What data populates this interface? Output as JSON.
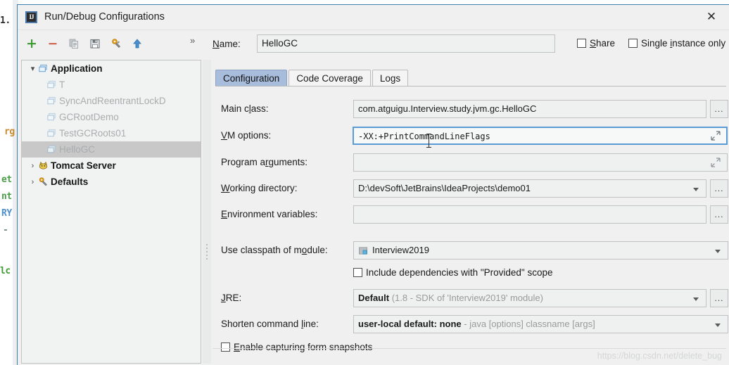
{
  "window": {
    "title": "Run/Debug Configurations",
    "icon": "intellij-idea-icon",
    "close_label": "✕"
  },
  "toolbar": {
    "items": [
      {
        "name": "add-configuration-button",
        "glyph": "plus",
        "color": "#3f9c35"
      },
      {
        "name": "remove-configuration-button",
        "glyph": "minus",
        "color": "#cc5a45"
      },
      {
        "name": "copy-configuration-button",
        "glyph": "copy",
        "color": "#9aa0a3"
      },
      {
        "name": "save-configuration-button",
        "glyph": "save",
        "color": "#6d7579"
      },
      {
        "name": "edit-defaults-button",
        "glyph": "wrench",
        "color": "#e3a01a"
      },
      {
        "name": "move-up-button",
        "glyph": "arrow-up",
        "color": "#4a8fd0"
      }
    ],
    "overflow_label": "»"
  },
  "name_field": {
    "label": "Name:",
    "label_mnemonic": "N",
    "value": "HelloGC",
    "placeholder": "Name"
  },
  "checkboxes": {
    "share": {
      "label": "Share",
      "mnemonic": "S",
      "checked": false
    },
    "single_instance": {
      "label": "Single instance only",
      "mnemonic": "i",
      "checked": false
    }
  },
  "tree": {
    "nodes": [
      {
        "label": "Application",
        "level": 0,
        "bold": true,
        "expanded": true,
        "twisty": "⌄",
        "icon": "application-icon",
        "selected": false
      },
      {
        "label": "T",
        "level": 1,
        "bold": false,
        "icon": "application-icon",
        "selected": false
      },
      {
        "label": "SyncAndReentrantLockD",
        "level": 1,
        "bold": false,
        "icon": "application-icon",
        "selected": false
      },
      {
        "label": "GCRootDemo",
        "level": 1,
        "bold": false,
        "icon": "application-icon",
        "selected": false
      },
      {
        "label": "TestGCRoots01",
        "level": 1,
        "bold": false,
        "icon": "application-icon",
        "selected": false
      },
      {
        "label": "HelloGC",
        "level": 1,
        "bold": false,
        "icon": "application-icon",
        "selected": true
      },
      {
        "label": "Tomcat Server",
        "level": 0,
        "bold": true,
        "expanded": false,
        "twisty": "›",
        "icon": "tomcat-icon",
        "selected": false
      },
      {
        "label": "Defaults",
        "level": 0,
        "bold": true,
        "expanded": false,
        "twisty": "›",
        "icon": "wrench-icon",
        "selected": false
      }
    ]
  },
  "tabs": [
    {
      "label": "Configuration",
      "active": true
    },
    {
      "label": "Code Coverage",
      "active": false
    },
    {
      "label": "Logs",
      "active": false
    }
  ],
  "form": {
    "main_class": {
      "label": "Main class:",
      "mnemonic_before": "Main c",
      "mnemonic": "l",
      "mnemonic_after": "ass:",
      "value": "com.atguigu.Interview.study.jvm.gc.HelloGC",
      "browse_label": "..."
    },
    "vm_options": {
      "label_before": "",
      "mnemonic": "VM",
      "label_after": " options:",
      "value": "-XX:+PrintCommandLineFlags",
      "focused": true,
      "expand_icon": "expand-arrows-icon"
    },
    "program_arguments": {
      "label_before": "Program a",
      "mnemonic": "r",
      "label_after": "guments:",
      "value": "",
      "expand_icon": "expand-arrows-icon"
    },
    "working_directory": {
      "mnemonic": "W",
      "label_after": "orking directory:",
      "value": "D:\\devSoft\\JetBrains\\IdeaProjects\\demo01",
      "browse_label": "..."
    },
    "environment_variables": {
      "mnemonic": "E",
      "label_after": "nvironment variables:",
      "value": "",
      "browse_label": "..."
    },
    "use_classpath_of_module": {
      "label_before": "Use classpath of m",
      "mnemonic": "o",
      "label_after": "dule:",
      "value": "Interview2019",
      "icon": "module-icon"
    },
    "include_provided": {
      "label": "Include dependencies with \"Provided\" scope",
      "checked": false
    },
    "jre": {
      "mnemonic": "J",
      "label_after": "RE:",
      "value_bold": "Default",
      "value_grey": "(1.8 - SDK of 'Interview2019' module)",
      "browse_label": "..."
    },
    "shorten_command_line": {
      "label_before": "Shorten command ",
      "mnemonic": "l",
      "label_after": "ine:",
      "value_bold": "user-local default: none",
      "value_grey": "- java [options] classname [args]"
    },
    "enable_capturing": {
      "label_before": "",
      "mnemonic": "E",
      "label_after": "nable capturing form snapshots",
      "checked": false
    }
  },
  "watermark": "https://blog.csdn.net/delete_bug",
  "background_editor": {
    "lines": [
      "1.",
      "rg",
      "et",
      "nt",
      "RY",
      "-",
      "lc"
    ]
  },
  "colors": {
    "dialog_bg": "#f0f0f0",
    "border": "#3c7fb1",
    "active_tab": "#a8bcdb",
    "selection": "#c8c8c8",
    "field_bg": "#eff0f0",
    "focus_ring": "#5b9bd5"
  }
}
